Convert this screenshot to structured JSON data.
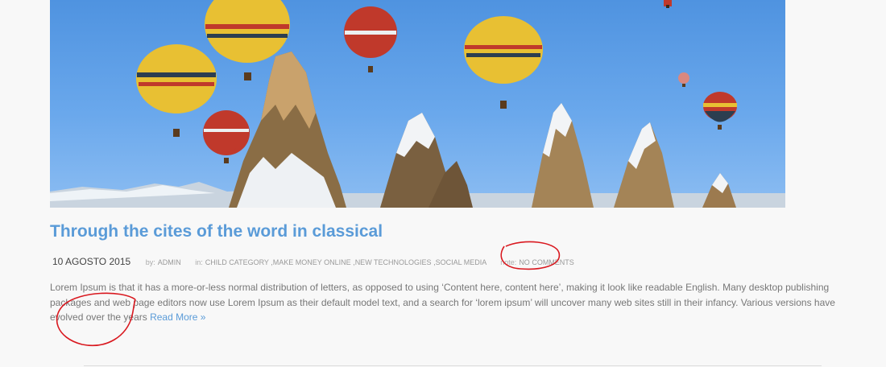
{
  "post": {
    "title": "Through the cites of the word in classical",
    "date": "10 AGOSTO 2015",
    "by_label": "by:",
    "author": "ADMIN",
    "in_label": "in:",
    "categories": [
      "CHILD CATEGORY",
      "MAKE MONEY ONLINE",
      "NEW TECHNOLOGIES",
      "SOCIAL MEDIA"
    ],
    "category_separator": ",",
    "note_label": "note:",
    "comments": "NO COMMENTS",
    "excerpt": "Lorem Ipsum is that it has a more-or-less normal distribution of letters, as opposed to using ‘Content here, content here’, making it look like readable English. Many desktop publishing packages and web page editors now use Lorem Ipsum as their default model text, and a search for ‘lorem ipsum’ will uncover many web sites still in their infancy. Various versions have evolved over the years",
    "read_more": "Read More »"
  },
  "image": {
    "subject": "hot-air-balloons-over-snowy-rock-spires"
  },
  "annotations": {
    "color": "#d9181f",
    "marks": [
      "circle-around-no-comments",
      "circle-around-read-more"
    ]
  },
  "colors": {
    "title": "#5a9bd8",
    "link": "#5a9bd8",
    "text": "#777777",
    "meta": "#aaaaaa",
    "sky": "#5c9de6"
  }
}
